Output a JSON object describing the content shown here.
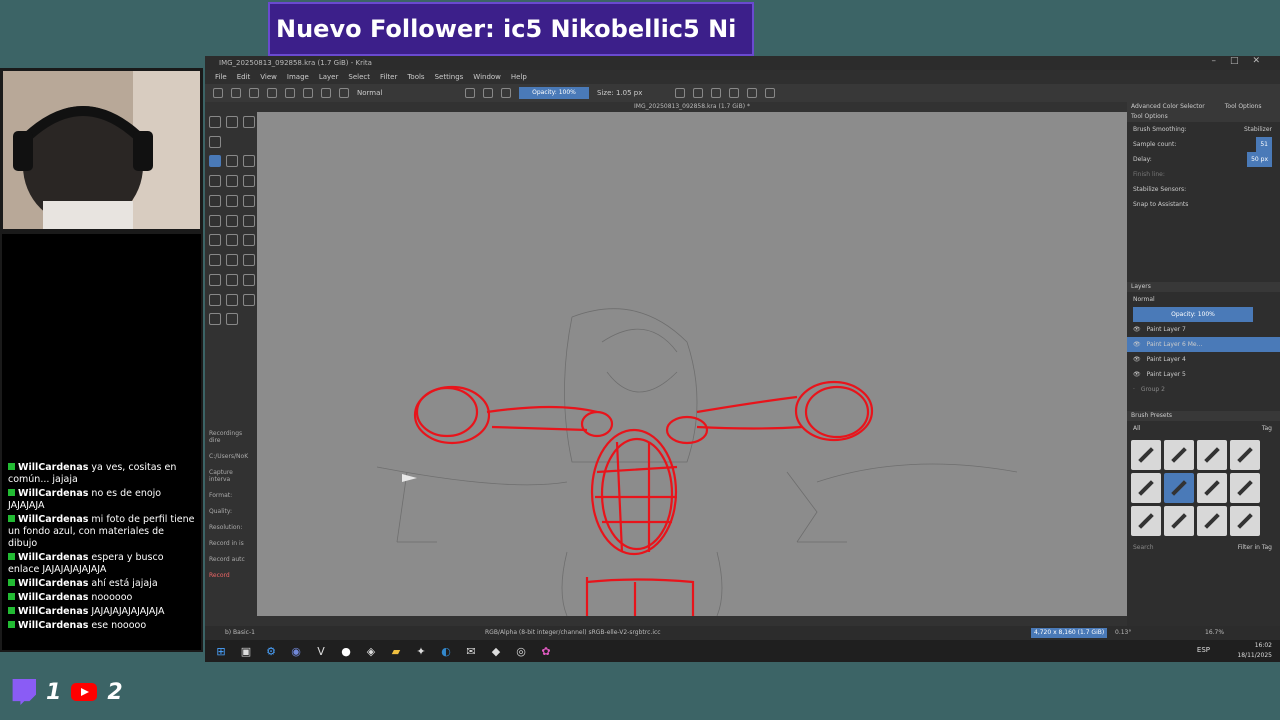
{
  "stream": {
    "banner_text": "Nuevo Follower: ic5 Nikobellic5 Ni",
    "twitch_count": "1",
    "youtube_count": "2"
  },
  "chat": [
    {
      "user": "WillCardenas",
      "text": "ya ves, cositas en común... jajaja"
    },
    {
      "user": "WillCardenas",
      "text": "no es de enojo JAJAJAJA"
    },
    {
      "user": "WillCardenas",
      "text": "mi foto de perfil tiene un fondo azul, con materiales de dibujo"
    },
    {
      "user": "WillCardenas",
      "text": "espera y busco enlace JAJAJAJAJAJAJA"
    },
    {
      "user": "WillCardenas",
      "text": "ahí está jajaja"
    },
    {
      "user": "WillCardenas",
      "text": "noooooo"
    },
    {
      "user": "WillCardenas",
      "text": "JAJAJAJAJAJAJAJA"
    },
    {
      "user": "WillCardenas",
      "text": "ese nooooo"
    }
  ],
  "krita": {
    "title": "IMG_20250813_092858.kra (1.7 GiB) - Krita",
    "menu": [
      "File",
      "Edit",
      "View",
      "Image",
      "Layer",
      "Select",
      "Filter",
      "Tools",
      "Settings",
      "Window",
      "Help"
    ],
    "blend_mode": "Normal",
    "opacity": "Opacity: 100%",
    "size": "Size: 1.05 px",
    "doc_tab": "IMG_20250813_092858.kra (1.7 GiB) *",
    "recorder": [
      "Recordings dire",
      "C:/Users/NoK",
      "Capture interva",
      "Format:",
      "Quality:",
      "Resolution:",
      "Record in is",
      "Record autc"
    ],
    "record_button": "Record",
    "status_left": "b) Basic-1",
    "status_center": "RGB/Alpha (8-bit integer/channel)  sRGB-elle-V2-srgbtrc.icc",
    "status_zoom": "16.7%",
    "status_size": "4,720 x 8,160 (1.7 GiB)",
    "status_rotation": "0.13°"
  },
  "tool_options": {
    "tabs": [
      "Advanced Color Selector",
      "Tool Options"
    ],
    "header": "Tool Options",
    "rows": [
      {
        "label": "Brush Smoothing:",
        "value": "Stabilizer"
      },
      {
        "label": "Sample count:",
        "value": "51"
      },
      {
        "label": "Delay:",
        "value": "50 px"
      },
      {
        "label": "Finish line:",
        "value": ""
      },
      {
        "label": "Stabilize Sensors:",
        "value": ""
      },
      {
        "label": "Snap to Assistants",
        "value": ""
      }
    ]
  },
  "layers": {
    "header": "Layers",
    "blend": "Normal",
    "opacity": "Opacity: 100%",
    "items": [
      {
        "name": "Paint Layer 7",
        "selected": false
      },
      {
        "name": "Paint Layer 6 Me...",
        "selected": true
      },
      {
        "name": "Paint Layer 4",
        "selected": false
      },
      {
        "name": "Paint Layer 5",
        "selected": false
      },
      {
        "name": "Group 2",
        "selected": false
      }
    ]
  },
  "brush_presets": {
    "header": "Brush Presets",
    "filter": "All",
    "tag_label": "Tag",
    "search_placeholder": "Search",
    "filter_in_tag": "Filter in Tag"
  },
  "taskbar": {
    "lang": "ESP",
    "time": "16:02",
    "date": "18/11/2025"
  }
}
